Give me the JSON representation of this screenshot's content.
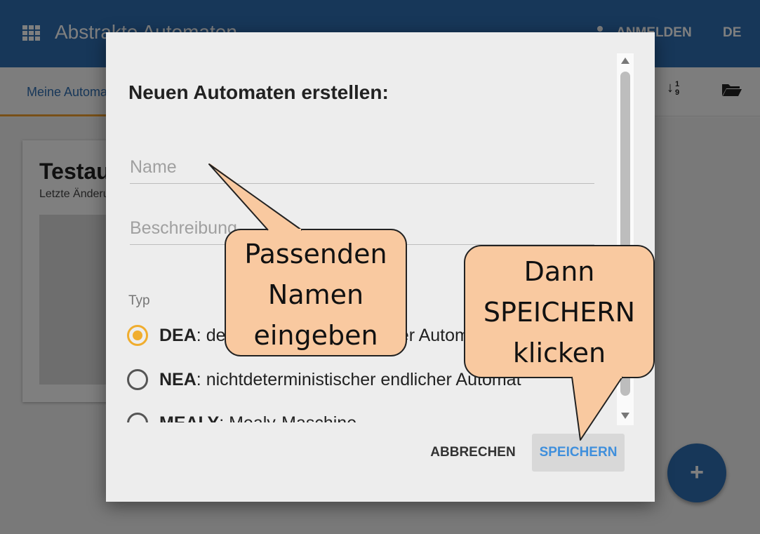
{
  "app": {
    "title": "Abstrakte Automaten",
    "login_label": "ANMELDEN",
    "language": "DE"
  },
  "tabs": {
    "active_label": "Meine Automaten"
  },
  "card": {
    "title": "Testautomat",
    "subtitle": "Letzte Änderung"
  },
  "fab": {
    "label": "+"
  },
  "dialog": {
    "title": "Neuen Automaten erstellen:",
    "name_placeholder": "Name",
    "description_placeholder": "Beschreibung",
    "type_label": "Typ",
    "types": [
      {
        "code": "DEA",
        "description": ": deterministischer endlicher Automat",
        "selected": true
      },
      {
        "code": "NEA",
        "description": ": nichtdeterministischer endlicher Automat",
        "selected": false
      },
      {
        "code": "MEALY",
        "description": ": Mealy-Maschine",
        "selected": false
      }
    ],
    "cancel_label": "ABBRECHEN",
    "save_label": "SPEICHERN"
  },
  "callouts": [
    {
      "lines": [
        "Passenden",
        "Namen",
        "eingeben"
      ]
    },
    {
      "lines": [
        "Dann",
        "SPEICHERN",
        "klicken"
      ]
    }
  ],
  "colors": {
    "appbar": "#2f6eb2",
    "accent": "#f0ad2e",
    "callout_fill": "#f9c9a0",
    "save_text": "#3f8fdc"
  }
}
